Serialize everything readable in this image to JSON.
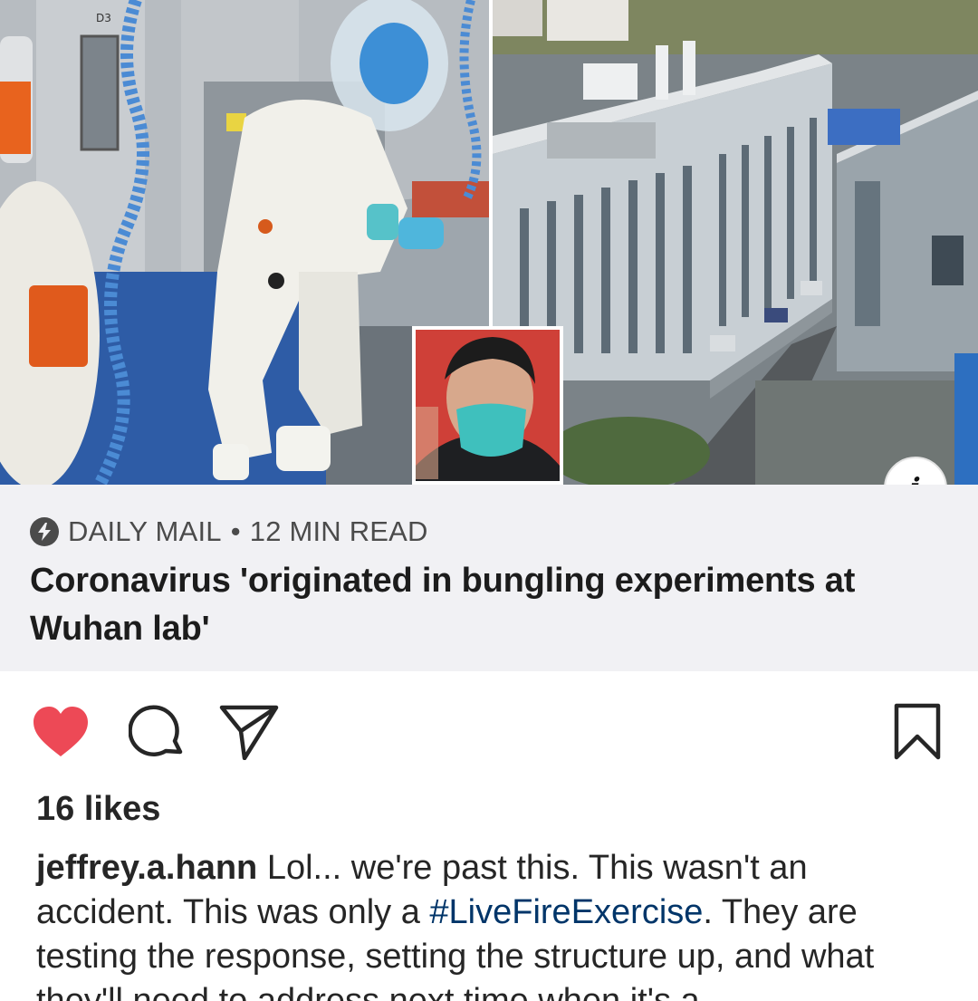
{
  "post": {
    "image": {
      "alt_panels": [
        "lab-photo",
        "building-photo",
        "inset-photo"
      ],
      "info_badge": "i"
    },
    "link_card": {
      "source": "DAILY MAIL",
      "separator": "•",
      "read_time": "12 MIN READ",
      "headline": "Coronavirus 'originated in bungling experiments at Wuhan lab'"
    },
    "actions": {
      "liked": true,
      "like_icon": "heart-icon",
      "comment_icon": "comment-icon",
      "share_icon": "paper-plane-icon",
      "save_icon": "bookmark-icon"
    },
    "likes_label": "16 likes",
    "caption": {
      "username": "jeffrey.a.hann",
      "text_before": " Lol... we're past this. This wasn't an accident. This was only a ",
      "hashtag": "#LiveFireExercise",
      "text_after": ". They are testing the response, setting the structure up, and what they'll need to address next time when it's a"
    }
  },
  "colors": {
    "heart": "#ed4956",
    "card_bg": "#f1f1f4",
    "hashtag": "#003569"
  }
}
